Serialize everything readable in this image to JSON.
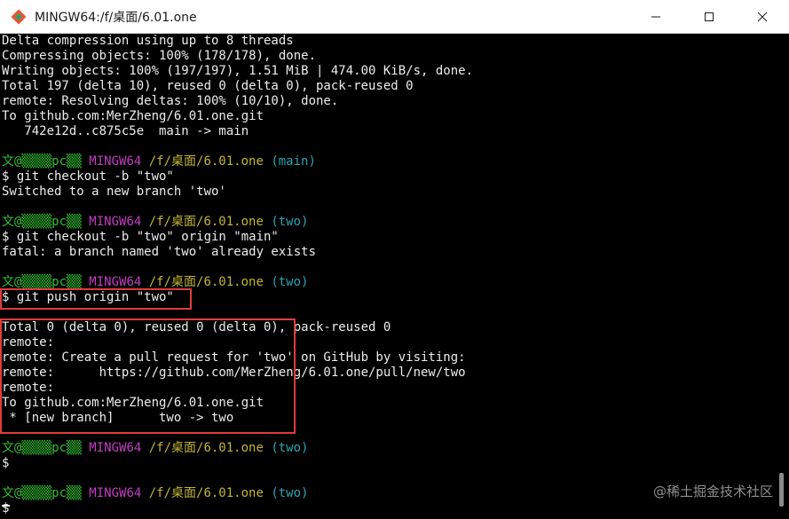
{
  "window": {
    "title": "MINGW64:/f/桌面/6.01.one",
    "app_icon": "git-bash-icon",
    "controls": [
      "minimize-icon",
      "maximize-icon",
      "close-icon"
    ]
  },
  "colors": {
    "prompt_user": "#2ec02e",
    "prompt_env": "#c33cc3",
    "prompt_path": "#c2b536",
    "prompt_branch": "#2aa5b2",
    "highlight": "#e23b3b"
  },
  "terminal": {
    "lines": [
      [
        {
          "t": "Delta compression using up to 8 threads",
          "c": "white"
        }
      ],
      [
        {
          "t": "Compressing objects: 100% (178/178), done.",
          "c": "white"
        }
      ],
      [
        {
          "t": "Writing objects: 100% (197/197), 1.51 MiB | 474.00 KiB/s, done.",
          "c": "white"
        }
      ],
      [
        {
          "t": "Total 197 (delta 10), reused 0 (delta 0), pack-reused 0",
          "c": "white"
        }
      ],
      [
        {
          "t": "remote: Resolving deltas: 100% (10/10), done.",
          "c": "white"
        }
      ],
      [
        {
          "t": "To github.com:MerZheng/6.01.one.git",
          "c": "white"
        }
      ],
      [
        {
          "t": "   742e12d..c875c5e  main -> main",
          "c": "white"
        }
      ],
      [],
      [
        {
          "t": "文@▒▒▒▒pc▒▒ ",
          "c": "green"
        },
        {
          "t": "MINGW64 ",
          "c": "magenta"
        },
        {
          "t": "/f/桌面/6.01.one ",
          "c": "yellow"
        },
        {
          "t": "(main)",
          "c": "cyan"
        }
      ],
      [
        {
          "t": "$ git checkout -b \"two\"",
          "c": "white"
        }
      ],
      [
        {
          "t": "Switched to a new branch 'two'",
          "c": "white"
        }
      ],
      [],
      [
        {
          "t": "文@▒▒▒▒pc▒▒ ",
          "c": "green"
        },
        {
          "t": "MINGW64 ",
          "c": "magenta"
        },
        {
          "t": "/f/桌面/6.01.one ",
          "c": "yellow"
        },
        {
          "t": "(two)",
          "c": "cyan"
        }
      ],
      [
        {
          "t": "$ git checkout -b \"two\" origin \"main\"",
          "c": "white"
        }
      ],
      [
        {
          "t": "fatal: a branch named 'two' already exists",
          "c": "white"
        }
      ],
      [],
      [
        {
          "t": "文@▒▒▒▒pc▒▒ ",
          "c": "green"
        },
        {
          "t": "MINGW64 ",
          "c": "magenta"
        },
        {
          "t": "/f/桌面/6.01.one ",
          "c": "yellow"
        },
        {
          "t": "(two)",
          "c": "cyan"
        }
      ],
      [
        {
          "t": "$ git push origin \"two\"",
          "c": "white"
        }
      ],
      [],
      [
        {
          "t": "Total 0 (delta 0), reused 0 (delta 0), pack-reused 0",
          "c": "white"
        }
      ],
      [
        {
          "t": "remote:",
          "c": "white"
        }
      ],
      [
        {
          "t": "remote: Create a pull request for 'two' on GitHub by visiting:",
          "c": "white"
        }
      ],
      [
        {
          "t": "remote:      https://github.com/MerZheng/6.01.one/pull/new/two",
          "c": "white"
        }
      ],
      [
        {
          "t": "remote:",
          "c": "white"
        }
      ],
      [
        {
          "t": "To github.com:MerZheng/6.01.one.git",
          "c": "white"
        }
      ],
      [
        {
          "t": " * [new branch]      two -> two",
          "c": "white"
        }
      ],
      [],
      [
        {
          "t": "文@▒▒▒▒pc▒▒ ",
          "c": "green"
        },
        {
          "t": "MINGW64 ",
          "c": "magenta"
        },
        {
          "t": "/f/桌面/6.01.one ",
          "c": "yellow"
        },
        {
          "t": "(two)",
          "c": "cyan"
        }
      ],
      [
        {
          "t": "$",
          "c": "white"
        }
      ],
      [],
      [
        {
          "t": "文@▒▒▒▒pc▒▒ ",
          "c": "green"
        },
        {
          "t": "MINGW64 ",
          "c": "magenta"
        },
        {
          "t": "/f/桌面/6.01.one ",
          "c": "yellow"
        },
        {
          "t": "(two)",
          "c": "cyan"
        }
      ],
      [
        {
          "t": "$",
          "c": "white"
        }
      ]
    ]
  },
  "watermark": "@稀土掘金技术社区"
}
